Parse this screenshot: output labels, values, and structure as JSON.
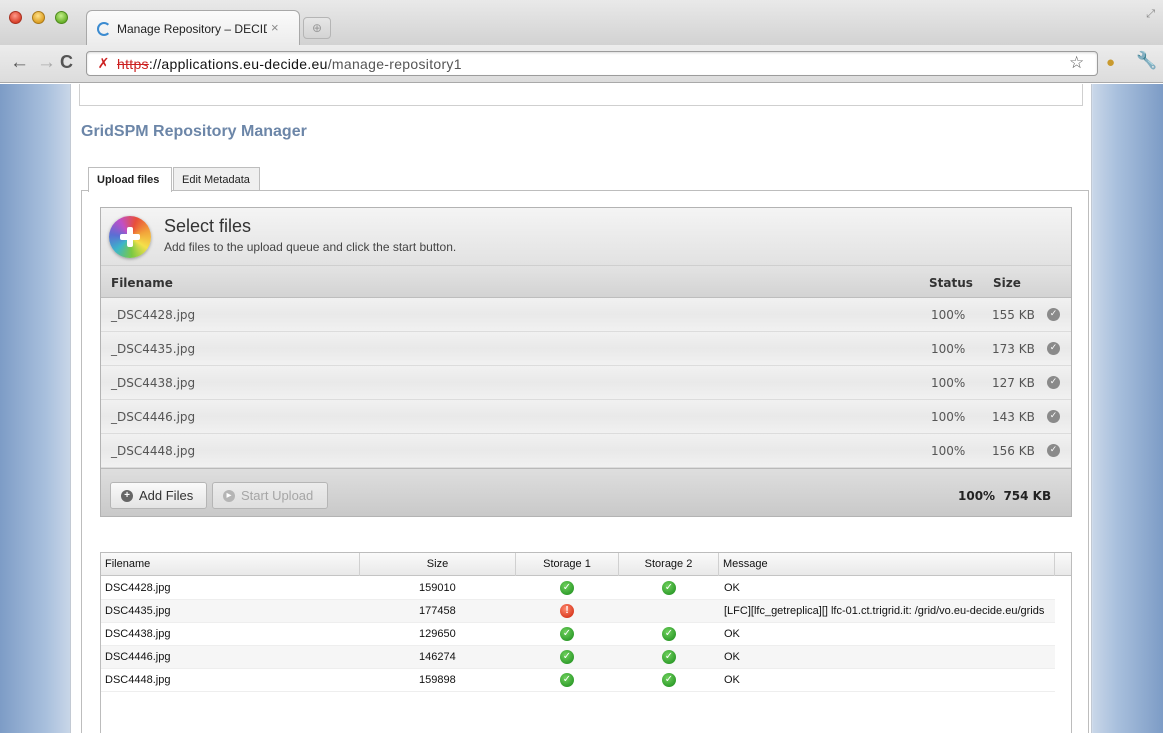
{
  "browser": {
    "tab_title": "Manage Repository – DECIDE",
    "tab_close": "×",
    "url_scheme": "https",
    "url_rest_host": "://applications.eu-decide.eu",
    "url_path": "/manage-repository1"
  },
  "page": {
    "title": "GridSPM Repository Manager",
    "tabs": [
      {
        "label": "Upload files",
        "active": true
      },
      {
        "label": "Edit Metadata",
        "active": false
      }
    ]
  },
  "uploader": {
    "title": "Select files",
    "subtitle": "Add files to the upload queue and click the start button.",
    "columns": {
      "filename": "Filename",
      "status": "Status",
      "size": "Size"
    },
    "files": [
      {
        "name": "_DSC4428.jpg",
        "status": "100%",
        "size": "155 KB"
      },
      {
        "name": "_DSC4435.jpg",
        "status": "100%",
        "size": "173 KB"
      },
      {
        "name": "_DSC4438.jpg",
        "status": "100%",
        "size": "127 KB"
      },
      {
        "name": "_DSC4446.jpg",
        "status": "100%",
        "size": "143 KB"
      },
      {
        "name": "_DSC4448.jpg",
        "status": "100%",
        "size": "156 KB"
      }
    ],
    "add_files_label": "Add Files",
    "start_upload_label": "Start Upload",
    "total_percent": "100%",
    "total_size": "754 KB"
  },
  "results": {
    "columns": [
      "Filename",
      "Size",
      "Storage 1",
      "Storage 2",
      "Message"
    ],
    "rows": [
      {
        "filename": "DSC4428.jpg",
        "size": "159010",
        "storage1": "ok",
        "storage2": "ok",
        "message": "OK"
      },
      {
        "filename": "DSC4435.jpg",
        "size": "177458",
        "storage1": "error",
        "storage2": "",
        "message": "[LFC][lfc_getreplica][] lfc-01.ct.trigrid.it: /grid/vo.eu-decide.eu/grids"
      },
      {
        "filename": "DSC4438.jpg",
        "size": "129650",
        "storage1": "ok",
        "storage2": "ok",
        "message": "OK"
      },
      {
        "filename": "DSC4446.jpg",
        "size": "146274",
        "storage1": "ok",
        "storage2": "ok",
        "message": "OK"
      },
      {
        "filename": "DSC4448.jpg",
        "size": "159898",
        "storage1": "ok",
        "storage2": "ok",
        "message": "OK"
      }
    ]
  },
  "icons": {
    "ok": "check-circle-icon",
    "error": "exclamation-circle-icon",
    "done": "check-icon"
  },
  "colors": {
    "title": "#6c86a8",
    "ok": "#2e9b2a",
    "error": "#d8391f",
    "insecure": "#cc2020"
  }
}
